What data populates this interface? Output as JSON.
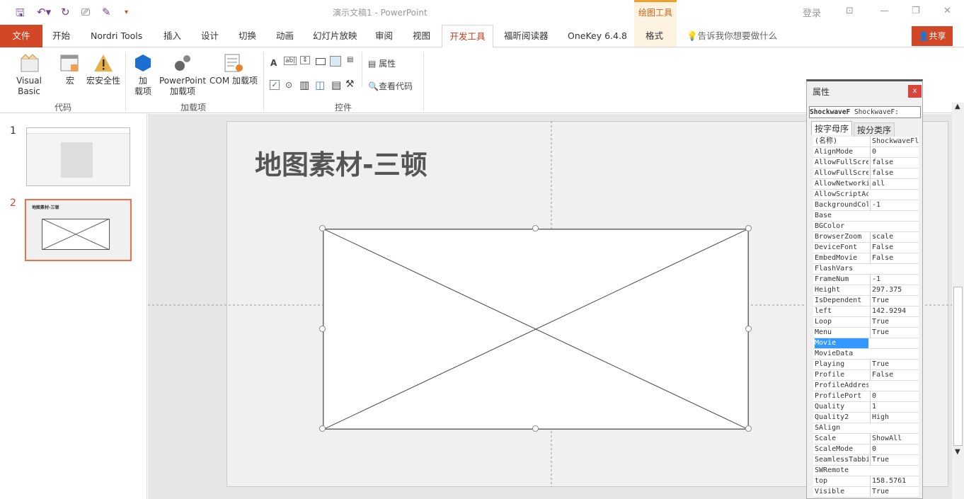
{
  "window": {
    "title": "演示文稿1 - PowerPoint",
    "contextual_tab_group": "绘图工具",
    "login": "登录",
    "share": "共享"
  },
  "tabs": [
    {
      "label": "文件"
    },
    {
      "label": "开始"
    },
    {
      "label": "Nordri Tools"
    },
    {
      "label": "插入"
    },
    {
      "label": "设计"
    },
    {
      "label": "切换"
    },
    {
      "label": "动画"
    },
    {
      "label": "幻灯片放映"
    },
    {
      "label": "审阅"
    },
    {
      "label": "视图"
    },
    {
      "label": "开发工具",
      "active": true
    },
    {
      "label": "福昕阅读器"
    },
    {
      "label": "OneKey 6.4.8"
    },
    {
      "label": "格式"
    }
  ],
  "tell_me": "告诉我你想要做什么",
  "ribbon": {
    "code": {
      "label": "代码",
      "visual_basic": "Visual Basic",
      "macro": "宏",
      "macro_security": "宏安全性"
    },
    "addins": {
      "label": "加载项",
      "addins_1": "加",
      "addins_2": "载项",
      "ppt_addins_1": "PowerPoint",
      "ppt_addins_2": "加载项",
      "com_addins": "COM 加载项"
    },
    "controls": {
      "label": "控件",
      "properties": "属性",
      "view_code": "查看代码"
    }
  },
  "thumbnails": [
    {
      "number": "1"
    },
    {
      "number": "2",
      "title": "地图素材-三顿",
      "selected": true
    }
  ],
  "slide": {
    "title": "地图素材-三顿"
  },
  "properties_panel": {
    "title": "属性",
    "close": "x",
    "object_name": "ShockwaveF",
    "object_type": "ShockwaveF:",
    "tab_alpha": "按字母序",
    "tab_category": "按分类序",
    "rows": [
      {
        "k": "(名称)",
        "v": "ShockwaveFl:"
      },
      {
        "k": "AlignMode",
        "v": "0"
      },
      {
        "k": "AllowFullScre",
        "v": "false"
      },
      {
        "k": "AllowFullScre",
        "v": "false"
      },
      {
        "k": "AllowNetworki",
        "v": "all"
      },
      {
        "k": "AllowScriptAc",
        "v": ""
      },
      {
        "k": "BackgroundCol",
        "v": "-1"
      },
      {
        "k": "Base",
        "v": ""
      },
      {
        "k": "BGColor",
        "v": ""
      },
      {
        "k": "BrowserZoom",
        "v": "scale"
      },
      {
        "k": "DeviceFont",
        "v": "False"
      },
      {
        "k": "EmbedMovie",
        "v": "False"
      },
      {
        "k": "FlashVars",
        "v": ""
      },
      {
        "k": "FrameNum",
        "v": "-1"
      },
      {
        "k": "Height",
        "v": "297.375"
      },
      {
        "k": "IsDependent",
        "v": "True"
      },
      {
        "k": "left",
        "v": "142.9294"
      },
      {
        "k": "Loop",
        "v": "True"
      },
      {
        "k": "Menu",
        "v": "True"
      },
      {
        "k": "Movie",
        "v": "",
        "selected": true
      },
      {
        "k": "MovieData",
        "v": ""
      },
      {
        "k": "Playing",
        "v": "True"
      },
      {
        "k": "Profile",
        "v": "False"
      },
      {
        "k": "ProfileAddres",
        "v": ""
      },
      {
        "k": "ProfilePort",
        "v": "0"
      },
      {
        "k": "Quality",
        "v": "1"
      },
      {
        "k": "Quality2",
        "v": "High"
      },
      {
        "k": "SAlign",
        "v": ""
      },
      {
        "k": "Scale",
        "v": "ShowAll"
      },
      {
        "k": "ScaleMode",
        "v": "0"
      },
      {
        "k": "SeamlessTabbi",
        "v": "True"
      },
      {
        "k": "SWRemote",
        "v": ""
      },
      {
        "k": "top",
        "v": "158.5761"
      },
      {
        "k": "Visible",
        "v": "True"
      }
    ]
  }
}
